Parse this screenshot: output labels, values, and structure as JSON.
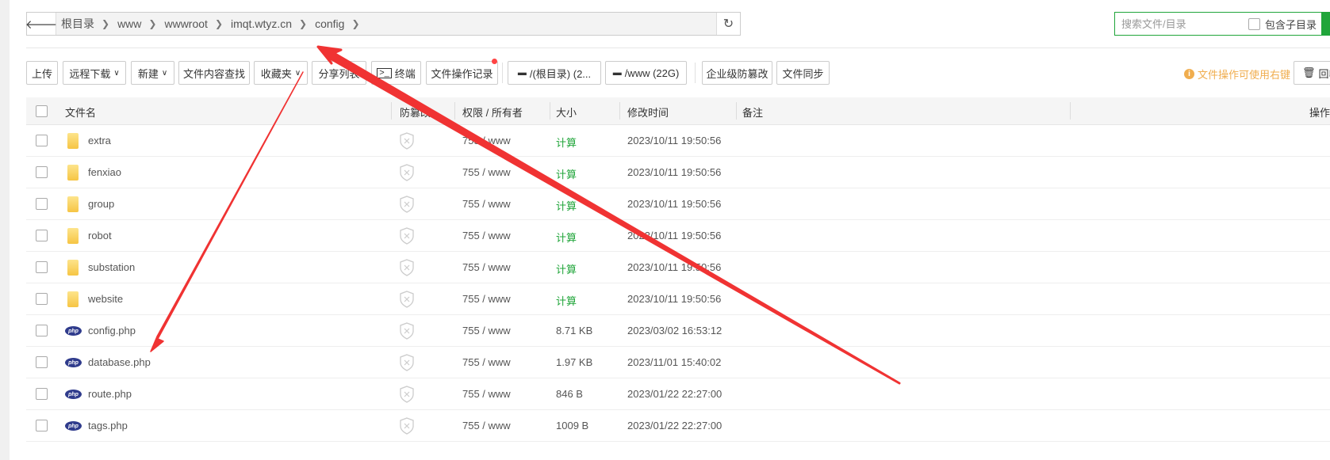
{
  "breadcrumb": {
    "items": [
      "根目录",
      "www",
      "wwwroot",
      "imqt.wtyz.cn",
      "config"
    ]
  },
  "search": {
    "placeholder": "搜索文件/目录",
    "include_subdir_label": "包含子目录"
  },
  "toolbar": {
    "buttons": [
      {
        "label": "上传",
        "dropdown": false
      },
      {
        "label": "远程下载",
        "dropdown": true
      },
      {
        "label": "新建",
        "dropdown": true
      },
      {
        "label": "文件内容查找",
        "dropdown": false
      },
      {
        "label": "收藏夹",
        "dropdown": true
      },
      {
        "label": "分享列表",
        "dropdown": false
      },
      {
        "label": "终端",
        "dropdown": false
      },
      {
        "label": "文件操作记录",
        "dropdown": false
      }
    ],
    "disks": [
      "/(根目录) (2...",
      "/www (22G)"
    ],
    "extra": [
      "企业级防篡改",
      "文件同步"
    ],
    "tip": "文件操作可使用右键",
    "recycle_label": "回收"
  },
  "table": {
    "columns": [
      "文件名",
      "防篡改",
      "权限 / 所有者",
      "大小",
      "修改时间",
      "备注",
      "操作"
    ],
    "rows": [
      {
        "type": "folder",
        "name": "extra",
        "perm": "755 / www",
        "size": "计算",
        "mtime": "2023/10/11 19:50:56"
      },
      {
        "type": "folder",
        "name": "fenxiao",
        "perm": "755 / www",
        "size": "计算",
        "mtime": "2023/10/11 19:50:56"
      },
      {
        "type": "folder",
        "name": "group",
        "perm": "755 / www",
        "size": "计算",
        "mtime": "2023/10/11 19:50:56"
      },
      {
        "type": "folder",
        "name": "robot",
        "perm": "755 / www",
        "size": "计算",
        "mtime": "2023/10/11 19:50:56"
      },
      {
        "type": "folder",
        "name": "substation",
        "perm": "755 / www",
        "size": "计算",
        "mtime": "2023/10/11 19:50:56"
      },
      {
        "type": "folder",
        "name": "website",
        "perm": "755 / www",
        "size": "计算",
        "mtime": "2023/10/11 19:50:56"
      },
      {
        "type": "php",
        "name": "config.php",
        "perm": "755 / www",
        "size": "8.71 KB",
        "mtime": "2023/03/02 16:53:12"
      },
      {
        "type": "php",
        "name": "database.php",
        "perm": "755 / www",
        "size": "1.97 KB",
        "mtime": "2023/11/01 15:40:02"
      },
      {
        "type": "php",
        "name": "route.php",
        "perm": "755 / www",
        "size": "846 B",
        "mtime": "2023/01/22 22:27:00"
      },
      {
        "type": "php",
        "name": "tags.php",
        "perm": "755 / www",
        "size": "1009 B",
        "mtime": "2023/01/22 22:27:00"
      }
    ]
  },
  "php_icon_text": "php",
  "colors": {
    "accent": "#20a53a",
    "warning": "#f0ad4e",
    "annotation": "#f03333"
  }
}
